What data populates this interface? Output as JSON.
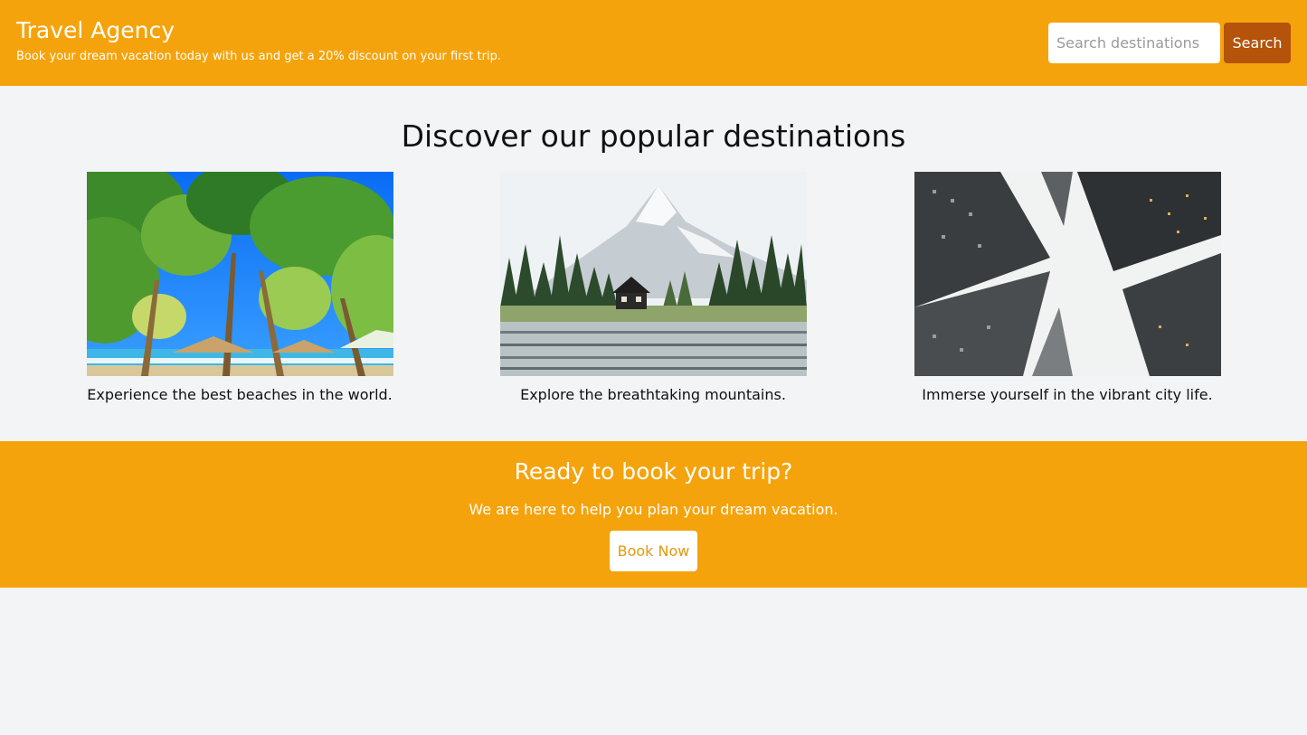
{
  "header": {
    "title": "Travel Agency",
    "tagline": "Book your dream vacation today with us and get a 20% discount on your first trip.",
    "search_placeholder": "Search destinations",
    "search_button": "Search"
  },
  "destinations": {
    "heading": "Discover our popular destinations",
    "cards": [
      {
        "caption": "Experience the best beaches in the world.",
        "image": "beach-photo"
      },
      {
        "caption": "Explore the breathtaking mountains.",
        "image": "mountain-lake-photo"
      },
      {
        "caption": "Immerse yourself in the vibrant city life.",
        "image": "city-skyscrapers-photo"
      }
    ]
  },
  "cta": {
    "title": "Ready to book your trip?",
    "text": "We are here to help you plan your dream vacation.",
    "button": "Book Now"
  },
  "colors": {
    "accent": "#f5a30c",
    "search_button": "#b45309",
    "background": "#f3f4f6"
  }
}
